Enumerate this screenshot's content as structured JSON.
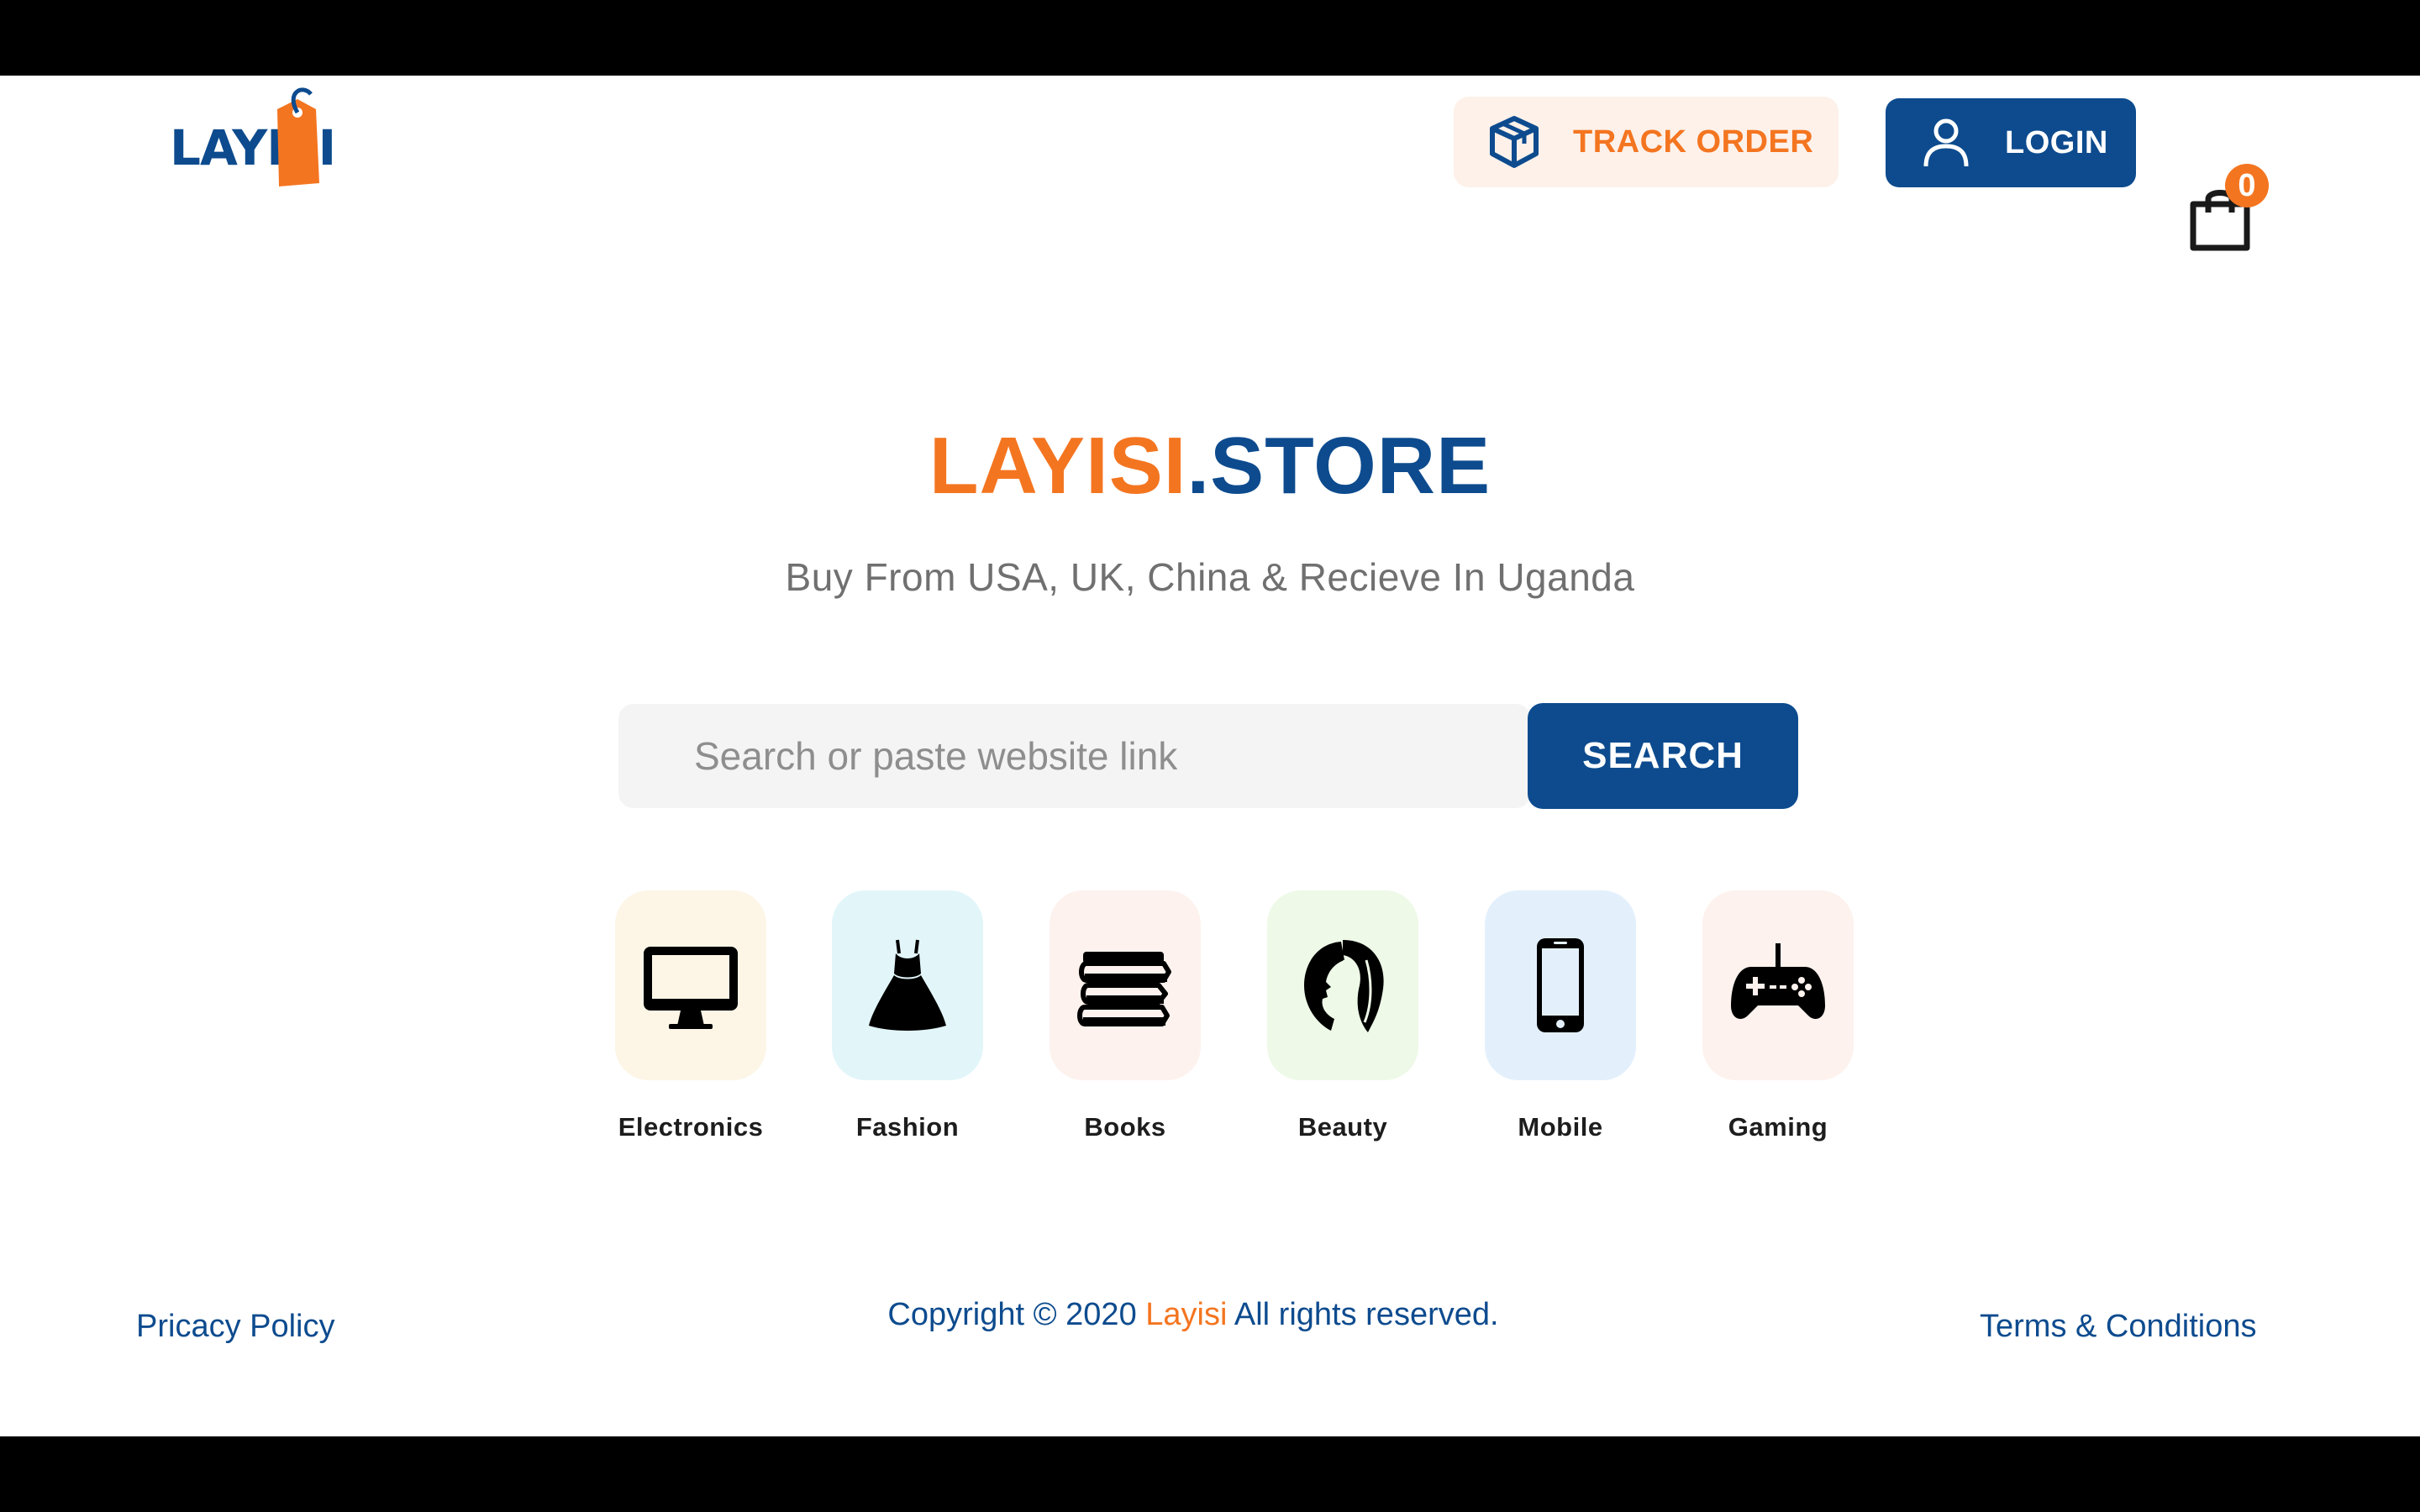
{
  "brand": {
    "logo_text_a": "LAYI",
    "logo_text_b": "S",
    "logo_text_c": "I",
    "primary_color": "#0d4b8e",
    "accent_color": "#f47520"
  },
  "header": {
    "track_order_label": "TRACK ORDER",
    "track_order_icon": "package-box-icon",
    "login_label": "LOGIN",
    "login_icon": "user-icon",
    "cart_icon": "shopping-bag-icon",
    "cart_count": "0"
  },
  "hero": {
    "title_part1": "LAYISI",
    "title_part2": ".STORE",
    "subtitle": "Buy From USA, UK, China & Recieve In Uganda"
  },
  "search": {
    "placeholder": "Search or paste website link",
    "value": "",
    "button_label": "SEARCH"
  },
  "categories": [
    {
      "label": "Electronics",
      "icon": "desktop-monitor-icon",
      "bg": "#fdf6e7"
    },
    {
      "label": "Fashion",
      "icon": "dress-icon",
      "bg": "#e2f6fa"
    },
    {
      "label": "Books",
      "icon": "books-stack-icon",
      "bg": "#fdf2ee"
    },
    {
      "label": "Beauty",
      "icon": "woman-face-hair-icon",
      "bg": "#eef9e8"
    },
    {
      "label": "Mobile",
      "icon": "smartphone-icon",
      "bg": "#e3f0fc"
    },
    {
      "label": "Gaming",
      "icon": "gamepad-icon",
      "bg": "#fdf2ee"
    }
  ],
  "footer": {
    "privacy_label": "Pricacy Policy",
    "copyright_prefix": "Copyright © 2020 ",
    "copyright_brand": "Layisi",
    "copyright_suffix": " All rights reserved.",
    "terms_label": "Terms & Conditions"
  }
}
